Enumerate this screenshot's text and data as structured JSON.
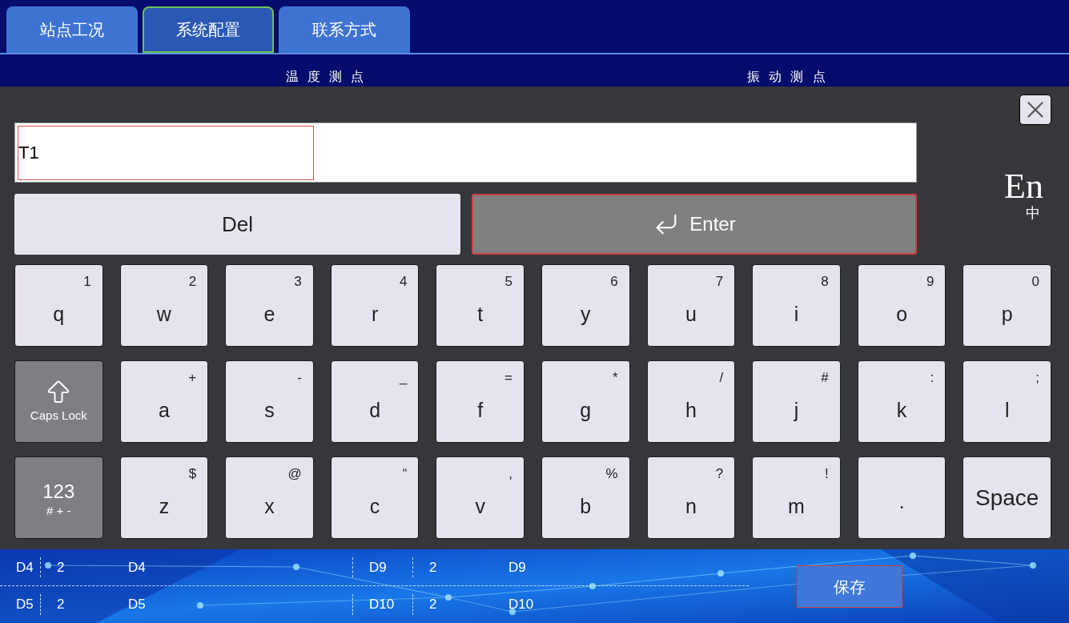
{
  "tabs": [
    {
      "label": "站点工况",
      "selected": false
    },
    {
      "label": "系统配置",
      "selected": true
    },
    {
      "label": "联系方式",
      "selected": false
    }
  ],
  "section_headers": [
    "温 度 测 点",
    "振 动 测 点"
  ],
  "keyboard": {
    "value": "T1",
    "delete": "Del",
    "enter": "Enter",
    "language": {
      "primary": "En",
      "secondary": "中"
    },
    "rows": [
      [
        {
          "kind": "char",
          "main": "q",
          "alt": "1"
        },
        {
          "kind": "char",
          "main": "w",
          "alt": "2"
        },
        {
          "kind": "char",
          "main": "e",
          "alt": "3"
        },
        {
          "kind": "char",
          "main": "r",
          "alt": "4"
        },
        {
          "kind": "char",
          "main": "t",
          "alt": "5"
        },
        {
          "kind": "char",
          "main": "y",
          "alt": "6"
        },
        {
          "kind": "char",
          "main": "u",
          "alt": "7"
        },
        {
          "kind": "char",
          "main": "i",
          "alt": "8"
        },
        {
          "kind": "char",
          "main": "o",
          "alt": "9"
        },
        {
          "kind": "char",
          "main": "p",
          "alt": "0"
        }
      ],
      [
        {
          "kind": "caps",
          "main": "Caps Lock"
        },
        {
          "kind": "char",
          "main": "a",
          "alt": "+"
        },
        {
          "kind": "char",
          "main": "s",
          "alt": "-"
        },
        {
          "kind": "char",
          "main": "d",
          "alt": "_"
        },
        {
          "kind": "char",
          "main": "f",
          "alt": "="
        },
        {
          "kind": "char",
          "main": "g",
          "alt": "*"
        },
        {
          "kind": "char",
          "main": "h",
          "alt": "/"
        },
        {
          "kind": "char",
          "main": "j",
          "alt": "#"
        },
        {
          "kind": "char",
          "main": "k",
          "alt": ":"
        },
        {
          "kind": "char",
          "main": "l",
          "alt": ";"
        }
      ],
      [
        {
          "kind": "symbols",
          "main": "123",
          "alt": "# + -"
        },
        {
          "kind": "char",
          "main": "z",
          "alt": "$"
        },
        {
          "kind": "char",
          "main": "x",
          "alt": "@"
        },
        {
          "kind": "char",
          "main": "c",
          "alt": "“"
        },
        {
          "kind": "char",
          "main": "v",
          "alt": ","
        },
        {
          "kind": "char",
          "main": "b",
          "alt": "%"
        },
        {
          "kind": "char",
          "main": "n",
          "alt": "?"
        },
        {
          "kind": "char",
          "main": "m",
          "alt": "!"
        },
        {
          "kind": "char",
          "main": "·"
        },
        {
          "kind": "space",
          "main": "Space"
        }
      ]
    ]
  },
  "table": {
    "rows": [
      [
        "D4",
        "2",
        "D4",
        "D9",
        "2",
        "D9"
      ],
      [
        "D5",
        "2",
        "D5",
        "D10",
        "2",
        "D10"
      ]
    ]
  },
  "save_button": "保存"
}
